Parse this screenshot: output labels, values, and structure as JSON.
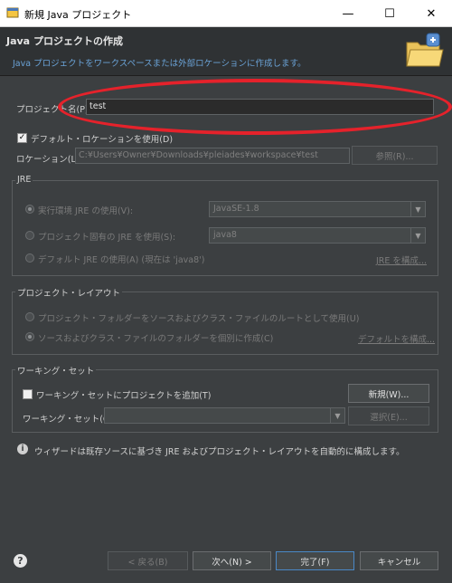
{
  "window": {
    "title": "新規 Java プロジェクト",
    "minimize": "—",
    "maximize": "☐",
    "close": "✕"
  },
  "header": {
    "title": "Java プロジェクトの作成",
    "subtitle": "Java プロジェクトをワークスペースまたは外部ロケーションに作成します。"
  },
  "project_name": {
    "label": "プロジェクト名(P):",
    "value": "test"
  },
  "default_location": {
    "label": "デフォルト・ロケーションを使用(D)",
    "checked": true
  },
  "location": {
    "label": "ロケーション(L):",
    "value": "C:¥Users¥Owner¥Downloads¥pleiades¥workspace¥test",
    "browse_label": "参照(R)..."
  },
  "jre": {
    "group_label": "JRE",
    "option_env_label": "実行環境 JRE の使用(V):",
    "option_env_value": "JavaSE-1.8",
    "option_project_label": "プロジェクト固有の JRE を使用(S):",
    "option_project_value": "java8",
    "option_default_label": "デフォルト JRE の使用(A) (現在は 'java8')",
    "configure_link": "JRE を構成..."
  },
  "layout": {
    "group_label": "プロジェクト・レイアウト",
    "option_root_label": "プロジェクト・フォルダーをソースおよびクラス・ファイルのルートとして使用(U)",
    "option_separate_label": "ソースおよびクラス・ファイルのフォルダーを個別に作成(C)",
    "configure_link": "デフォルトを構成..."
  },
  "working_sets": {
    "group_label": "ワーキング・セット",
    "add_label": "ワーキング・セットにプロジェクトを追加(T)",
    "add_checked": false,
    "new_label": "新規(W)...",
    "select_label": "ワーキング・セット(O):",
    "select_value": "",
    "select_button_label": "選択(E)..."
  },
  "info": {
    "text": "ウィザードは既存ソースに基づき JRE およびプロジェクト・レイアウトを自動的に構成します。"
  },
  "footer": {
    "help": "?",
    "back_label": "< 戻る(B)",
    "next_label": "次へ(N) >",
    "finish_label": "完了(F)",
    "cancel_label": "キャンセル"
  }
}
